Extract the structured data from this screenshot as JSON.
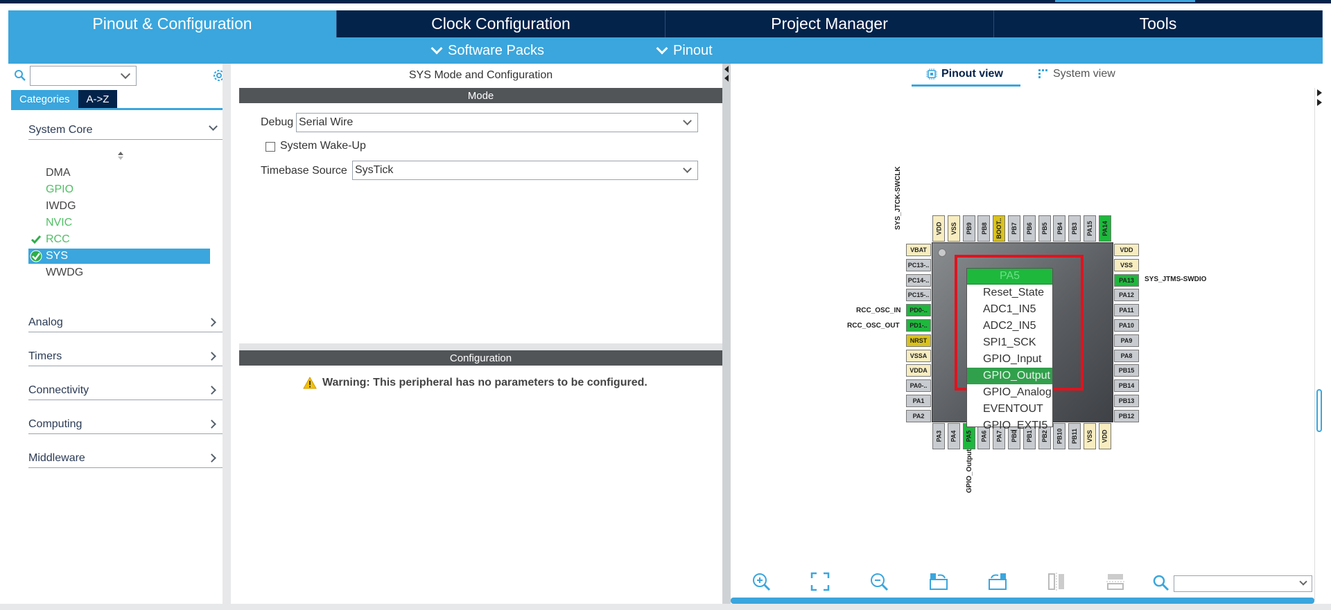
{
  "main_tabs": [
    {
      "label": "Pinout & Configuration",
      "active": true
    },
    {
      "label": "Clock Configuration",
      "active": false
    },
    {
      "label": "Project Manager",
      "active": false
    },
    {
      "label": "Tools",
      "active": false
    }
  ],
  "sub_menu": {
    "software_packs": "Software Packs",
    "pinout": "Pinout"
  },
  "left": {
    "category_tabs": [
      "Categories",
      "A->Z"
    ],
    "search_value": "",
    "system_core": "System Core",
    "peripherals": [
      {
        "label": "DMA",
        "state": "normal"
      },
      {
        "label": "GPIO",
        "state": "green"
      },
      {
        "label": "IWDG",
        "state": "normal"
      },
      {
        "label": "NVIC",
        "state": "green"
      },
      {
        "label": "RCC",
        "state": "checked"
      },
      {
        "label": "SYS",
        "state": "selected"
      },
      {
        "label": "WWDG",
        "state": "normal"
      }
    ],
    "groups": [
      "Analog",
      "Timers",
      "Connectivity",
      "Computing",
      "Middleware"
    ]
  },
  "middle": {
    "title": "SYS Mode and Configuration",
    "mode_header": "Mode",
    "debug_label": "Debug",
    "debug_value": "Serial Wire",
    "wakeup_label": "System Wake-Up",
    "timebase_label": "Timebase Source",
    "timebase_value": "SysTick",
    "config_header": "Configuration",
    "warning": "Warning: This peripheral has no parameters to be configured."
  },
  "right": {
    "view_tabs": [
      "Pinout view",
      "System view"
    ],
    "popup": {
      "header": "PA5",
      "items": [
        "Reset_State",
        "ADC1_IN5",
        "ADC2_IN5",
        "SPI1_SCK",
        "GPIO_Input",
        "GPIO_Output",
        "GPIO_Analog",
        "EVENTOUT",
        "GPIO_EXTI5"
      ],
      "highlighted": "GPIO_Output"
    },
    "pins": {
      "top": [
        {
          "name": "VDD",
          "color": "#f7edc0"
        },
        {
          "name": "VSS",
          "color": "#f7edc0"
        },
        {
          "name": "PB9",
          "color": "#c8ccd0"
        },
        {
          "name": "PB8",
          "color": "#c8ccd0"
        },
        {
          "name": "BOOT..",
          "color": "#d9c21c"
        },
        {
          "name": "PB7",
          "color": "#c8ccd0"
        },
        {
          "name": "PB6",
          "color": "#c8ccd0"
        },
        {
          "name": "PB5",
          "color": "#c8ccd0"
        },
        {
          "name": "PB4",
          "color": "#c8ccd0"
        },
        {
          "name": "PB3",
          "color": "#c8ccd0"
        },
        {
          "name": "PA15",
          "color": "#c8ccd0"
        },
        {
          "name": "PA14",
          "color": "#1eb83d"
        }
      ],
      "left": [
        {
          "name": "VBAT",
          "color": "#f7edc0"
        },
        {
          "name": "PC13-..",
          "color": "#c8ccd0"
        },
        {
          "name": "PC14-..",
          "color": "#c8ccd0"
        },
        {
          "name": "PC15-..",
          "color": "#c8ccd0"
        },
        {
          "name": "PD0-..",
          "color": "#1eb83d"
        },
        {
          "name": "PD1-..",
          "color": "#1eb83d"
        },
        {
          "name": "NRST",
          "color": "#d9c21c"
        },
        {
          "name": "VSSA",
          "color": "#f7edc0"
        },
        {
          "name": "VDDA",
          "color": "#f7edc0"
        },
        {
          "name": "PA0-..",
          "color": "#c8ccd0"
        },
        {
          "name": "PA1",
          "color": "#c8ccd0"
        },
        {
          "name": "PA2",
          "color": "#c8ccd0"
        }
      ],
      "right": [
        {
          "name": "VDD",
          "color": "#f7edc0"
        },
        {
          "name": "VSS",
          "color": "#f7edc0"
        },
        {
          "name": "PA13",
          "color": "#1eb83d"
        },
        {
          "name": "PA12",
          "color": "#c8ccd0"
        },
        {
          "name": "PA11",
          "color": "#c8ccd0"
        },
        {
          "name": "PA10",
          "color": "#c8ccd0"
        },
        {
          "name": "PA9",
          "color": "#c8ccd0"
        },
        {
          "name": "PA8",
          "color": "#c8ccd0"
        },
        {
          "name": "PB15",
          "color": "#c8ccd0"
        },
        {
          "name": "PB14",
          "color": "#c8ccd0"
        },
        {
          "name": "PB13",
          "color": "#c8ccd0"
        },
        {
          "name": "PB12",
          "color": "#c8ccd0"
        }
      ],
      "bottom": [
        {
          "name": "PA3",
          "color": "#c8ccd0"
        },
        {
          "name": "PA4",
          "color": "#c8ccd0"
        },
        {
          "name": "PA5",
          "color": "#1eb83d"
        },
        {
          "name": "PA6",
          "color": "#c8ccd0"
        },
        {
          "name": "PA7",
          "color": "#c8ccd0"
        },
        {
          "name": "PB0",
          "color": "#c8ccd0"
        },
        {
          "name": "PB1",
          "color": "#c8ccd0"
        },
        {
          "name": "PB2",
          "color": "#c8ccd0"
        },
        {
          "name": "PB10",
          "color": "#c8ccd0"
        },
        {
          "name": "PB11",
          "color": "#c8ccd0"
        },
        {
          "name": "VSS",
          "color": "#f7edc0"
        },
        {
          "name": "VDD",
          "color": "#f7edc0"
        }
      ]
    },
    "labels": {
      "swclk": "SYS_JTCK-SWCLK",
      "swdio": "SYS_JTMS-SWDIO",
      "osc_in": "RCC_OSC_IN",
      "osc_out": "RCC_OSC_OUT",
      "gpio_output": "GPIO_Output"
    },
    "zoom_value": ""
  },
  "colors": {
    "dark_blue": "#03234b",
    "accent_blue": "#3aa6dd",
    "pin_green": "#1eb83d",
    "highlight": "#e0131f"
  }
}
